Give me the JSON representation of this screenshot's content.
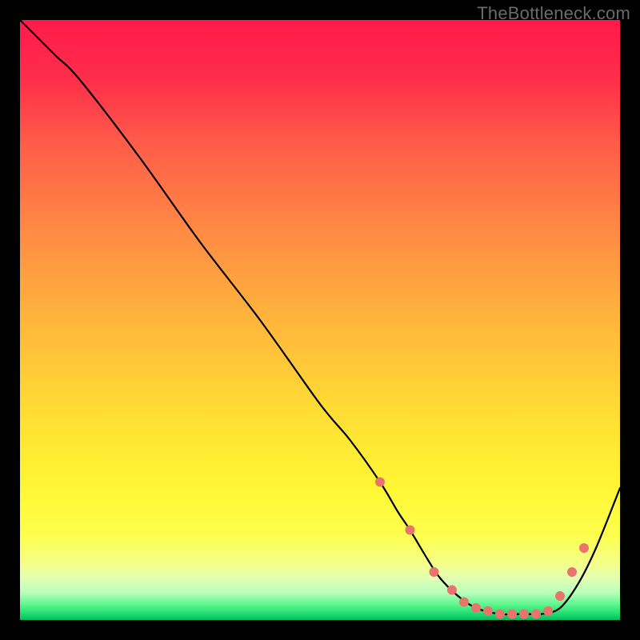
{
  "watermark": "TheBottleneck.com",
  "chart_data": {
    "type": "line",
    "title": "",
    "xlabel": "",
    "ylabel": "",
    "xlim": [
      0,
      100
    ],
    "ylim": [
      0,
      100
    ],
    "grid": false,
    "series": [
      {
        "name": "curve",
        "color": "#000000",
        "x": [
          0,
          4,
          6,
          10,
          20,
          30,
          40,
          50,
          55,
          60,
          63,
          65,
          68,
          70,
          73,
          76,
          80,
          84,
          87,
          90,
          93,
          96,
          100
        ],
        "y": [
          100,
          96,
          94,
          90,
          77,
          63,
          50,
          36,
          30,
          23,
          18,
          15,
          10,
          7,
          4,
          2,
          1,
          1,
          1,
          2,
          6,
          12,
          22
        ]
      }
    ],
    "markers": {
      "name": "highlight-dots",
      "color": "#e9746c",
      "radius": 6,
      "points": [
        {
          "x": 60,
          "y": 23
        },
        {
          "x": 65,
          "y": 15
        },
        {
          "x": 69,
          "y": 8
        },
        {
          "x": 72,
          "y": 5
        },
        {
          "x": 74,
          "y": 3
        },
        {
          "x": 76,
          "y": 2
        },
        {
          "x": 78,
          "y": 1.5
        },
        {
          "x": 80,
          "y": 1
        },
        {
          "x": 82,
          "y": 1
        },
        {
          "x": 84,
          "y": 1
        },
        {
          "x": 86,
          "y": 1
        },
        {
          "x": 88,
          "y": 1.5
        },
        {
          "x": 90,
          "y": 4
        },
        {
          "x": 92,
          "y": 8
        },
        {
          "x": 94,
          "y": 12
        }
      ]
    },
    "gradient_bands": [
      {
        "stop": 0.0,
        "color": "#ff1a4a"
      },
      {
        "stop": 0.1,
        "color": "#ff2e4a"
      },
      {
        "stop": 0.2,
        "color": "#ff5a49"
      },
      {
        "stop": 0.35,
        "color": "#ff8a44"
      },
      {
        "stop": 0.5,
        "color": "#ffb53c"
      },
      {
        "stop": 0.65,
        "color": "#ffdc34"
      },
      {
        "stop": 0.78,
        "color": "#fff733"
      },
      {
        "stop": 0.86,
        "color": "#fdff4e"
      },
      {
        "stop": 0.906,
        "color": "#f4ff8a"
      },
      {
        "stop": 0.93,
        "color": "#e3ffb3"
      },
      {
        "stop": 0.955,
        "color": "#b7ffba"
      },
      {
        "stop": 0.975,
        "color": "#59f68b"
      },
      {
        "stop": 0.993,
        "color": "#14d56b"
      },
      {
        "stop": 1.0,
        "color": "#07b85a"
      }
    ]
  }
}
